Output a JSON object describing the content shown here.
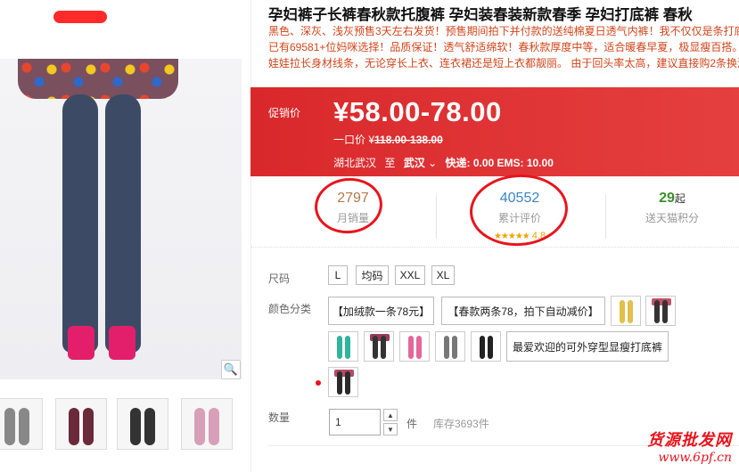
{
  "product": {
    "title": "孕妇裤子长裤春秋款托腹裤 孕妇装春装新款春季 孕妇打底裤 春秋",
    "desc_lines": [
      "黑色、深灰、浅灰预售3天左右发货！预售期间拍下并付款的送纯棉夏日透气内裤！我不仅仅是条打底",
      "已有69581+位妈咪选择！品质保证！透气舒适绵软！春秋款厚度中等，适合暖春早夏，极显瘦百搭。",
      "娃娃拉长身材线条，无论穿长上衣、连衣裙还是短上衣都靓丽。 由于回头率太高，建议直接购2条换洗"
    ]
  },
  "price": {
    "label": "促销价",
    "value": "¥58.00-78.00",
    "orig_label": "一口价 ¥",
    "orig_value": "118.00-138.00",
    "ship_from": "湖北武汉",
    "ship_to_word": "至",
    "ship_to": "武汉",
    "ship_to_chevron": "⌄",
    "shipping": "快递: 0.00 EMS: 10.00"
  },
  "stats": {
    "monthly_sales": "2797",
    "monthly_sales_label": "月销量",
    "reviews": "40552",
    "reviews_label": "累计评价",
    "rating_stars": "★★★★★",
    "rating": "4.8",
    "points": "29",
    "points_suffix": "起",
    "points_label": "送天猫积分"
  },
  "sku": {
    "size_label": "尺码",
    "sizes": [
      "L",
      "均码",
      "XXL",
      "XL"
    ],
    "color_label": "颜色分类",
    "color_text_opts": [
      "【加绒款一条78元】",
      "【春款两条78，拍下自动减价】",
      "最爱欢迎的可外穿型显瘦打底裤"
    ],
    "color_swatch_icons": [
      "yellow-pants-icon",
      "black-pants-skirt-icon",
      "teal-pants-icon",
      "black-pants-icon",
      "pink-pants-icon",
      "gray-pants-icon",
      "dark-pants-icon",
      "black-skirt-pants-icon"
    ]
  },
  "qty": {
    "label": "数量",
    "value": "1",
    "up": "▲",
    "down": "▼",
    "unit": "件",
    "stock": "库存3693件"
  },
  "zoom_icon": "🔍",
  "watermark": {
    "line1": "货源批发网",
    "line2": "www.6pf.cn"
  },
  "colors": {
    "accent_red": "#e4393c",
    "annotation_red": "#e8141c",
    "sales_color": "#b7784a",
    "reviews_color": "#3a85c6",
    "points_color": "#3a8f2a"
  }
}
